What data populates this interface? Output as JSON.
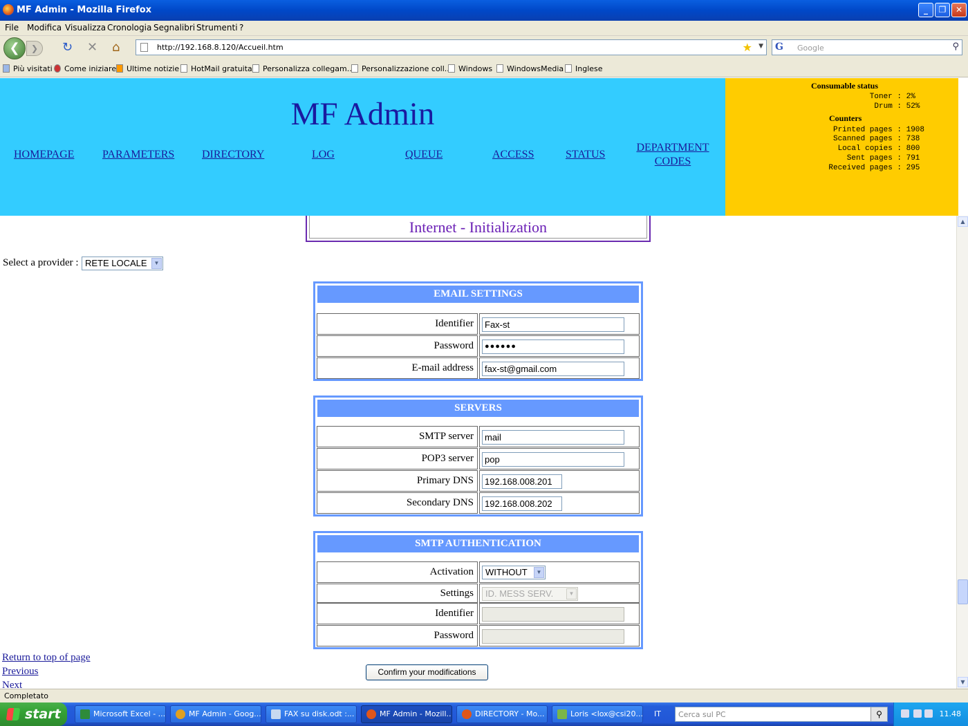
{
  "window": {
    "title": "MF Admin - Mozilla Firefox",
    "minimize_glyph": "_",
    "maximize_glyph": "❐",
    "close_glyph": "✕"
  },
  "menu": [
    "File",
    "Modifica",
    "Visualizza",
    "Cronologia",
    "Segnalibri",
    "Strumenti",
    "?"
  ],
  "toolbar": {
    "back_glyph": "❮",
    "forward_glyph": "❯",
    "reload_glyph": "↻",
    "stop_glyph": "✕",
    "home_glyph": "⌂",
    "url": "http://192.168.8.120/Accueil.htm",
    "search_placeholder": "Google",
    "search_engine_glyph": "G"
  },
  "bookmarks": [
    "Più visitati",
    "Come iniziare",
    "Ultime notizie",
    "HotMail gratuita",
    "Personalizza collegam...",
    "Personalizzazione coll...",
    "Windows",
    "WindowsMedia",
    "Inglese"
  ],
  "app": {
    "title": "MF Admin",
    "nav": [
      "HOMEPAGE",
      "PARAMETERS",
      "DIRECTORY",
      "LOG",
      "QUEUE",
      "ACCESS",
      "STATUS",
      "DEPARTMENT",
      "CODES"
    ]
  },
  "status_panel": {
    "consumable_heading": "Consumable status",
    "toner_label": "Toner :",
    "toner_value": "2%",
    "drum_label": "Drum :",
    "drum_value": "52%",
    "counters_heading": "Counters",
    "counters": [
      {
        "label": "Printed pages :",
        "value": "1908"
      },
      {
        "label": "Scanned pages :",
        "value": "738"
      },
      {
        "label": "Local copies :",
        "value": "800"
      },
      {
        "label": "Sent pages :",
        "value": "791"
      },
      {
        "label": "Received pages :",
        "value": "295"
      }
    ]
  },
  "page": {
    "heading": "Internet - Initialization",
    "provider_label": "Select a provider :",
    "provider_value": "RETE LOCALE"
  },
  "email": {
    "title": "EMAIL SETTINGS",
    "identifier_label": "Identifier",
    "identifier_value": "Fax-st",
    "password_label": "Password",
    "password_value": "●●●●●●",
    "email_label": "E-mail address",
    "email_value": "fax-st@gmail.com"
  },
  "servers": {
    "title": "SERVERS",
    "smtp_label": "SMTP server",
    "smtp_value": "mail",
    "pop3_label": "POP3 server",
    "pop3_value": "pop",
    "primary_dns_label": "Primary DNS",
    "primary_dns_value": "192.168.008.201",
    "secondary_dns_label": "Secondary DNS",
    "secondary_dns_value": "192.168.008.202"
  },
  "smtp_auth": {
    "title": "SMTP AUTHENTICATION",
    "activation_label": "Activation",
    "activation_value": "WITHOUT",
    "settings_label": "Settings",
    "settings_value": "ID. MESS SERV.",
    "identifier_label": "Identifier",
    "password_label": "Password"
  },
  "links": {
    "top": "Return to top of page",
    "previous": "Previous",
    "next": "Next",
    "confirm": "Confirm your modifications"
  },
  "statusbar": "Completato",
  "taskbar": {
    "start": "start",
    "tasks": [
      "Microsoft Excel - ...",
      "MF Admin - Goog...",
      "FAX su disk.odt :...",
      "MF Admin - Mozill...",
      "DIRECTORY - Mo...",
      "Loris <lox@csi20..."
    ],
    "lang": "IT",
    "search_placeholder": "Cerca sul PC",
    "clock": "11.48"
  }
}
